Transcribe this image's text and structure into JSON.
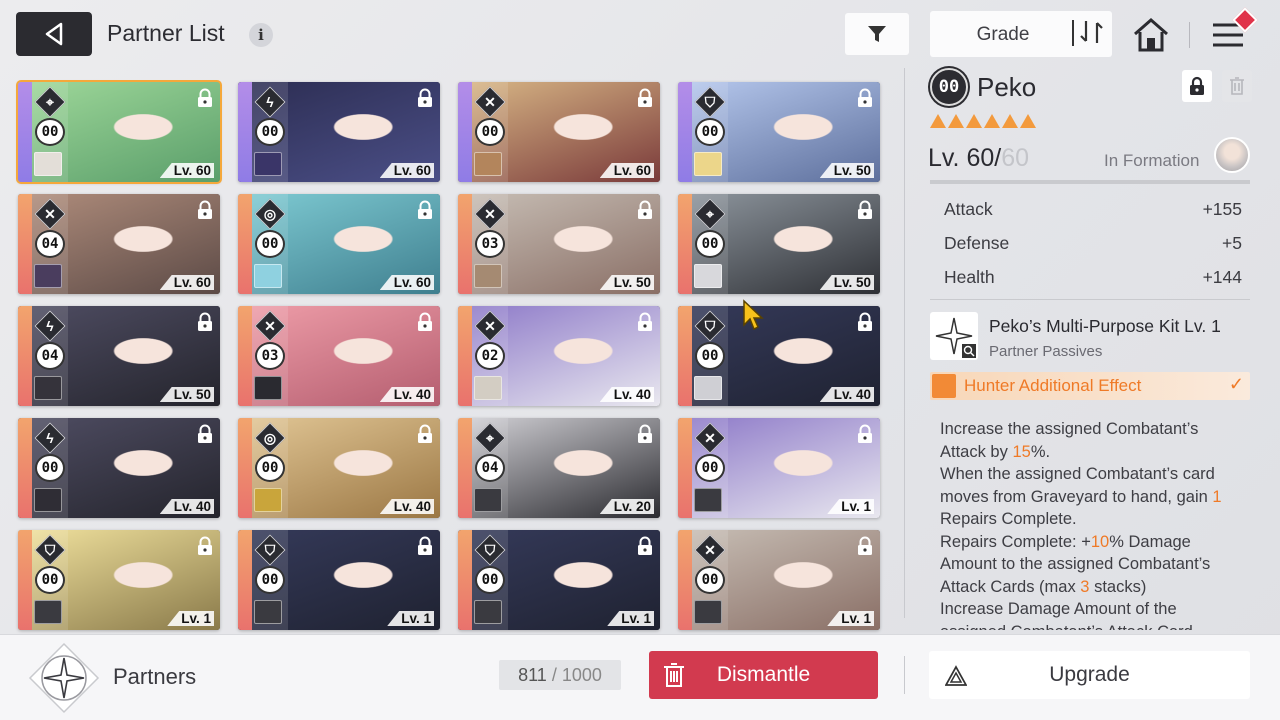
{
  "header": {
    "title": "Partner List",
    "info_icon": "i",
    "sort_label": "Grade"
  },
  "colors": {
    "accent_orange": "#f39a3d",
    "dismantle_red": "#d23a4f",
    "selected_outline": "#f5a83b",
    "rarity_orange": "#ec8a6d",
    "rarity_purple": "#a38ae7"
  },
  "cards": [
    {
      "role": "scope",
      "count": "00",
      "level": "Lv. 60",
      "rarity": "purple",
      "art": [
        "#9fd89a",
        "#5a9e6a"
      ],
      "mini": "#e3ded8",
      "selected": true
    },
    {
      "role": "bolt",
      "count": "00",
      "level": "Lv. 60",
      "rarity": "purple",
      "art": [
        "#2c2d52",
        "#4b4f87"
      ],
      "mini": "#3a3568",
      "selected": false
    },
    {
      "role": "swords",
      "count": "00",
      "level": "Lv. 60",
      "rarity": "purple",
      "art": [
        "#d9b887",
        "#7a3a3a"
      ],
      "mini": "#b3855c",
      "selected": false
    },
    {
      "role": "shield",
      "count": "00",
      "level": "Lv. 50",
      "rarity": "purple",
      "art": [
        "#b7c9ee",
        "#5d6f9c"
      ],
      "mini": "#ecd68a",
      "selected": false
    },
    {
      "role": "swords",
      "count": "04",
      "level": "Lv. 60",
      "rarity": "orange",
      "art": [
        "#b08d7c",
        "#5c4a46"
      ],
      "mini": "#4a3d5e",
      "selected": false
    },
    {
      "role": "target",
      "count": "00",
      "level": "Lv. 60",
      "rarity": "orange",
      "art": [
        "#7fcbd3",
        "#3f7f8f"
      ],
      "mini": "#8fd1e0",
      "selected": false
    },
    {
      "role": "swords",
      "count": "03",
      "level": "Lv. 50",
      "rarity": "orange",
      "art": [
        "#c8bfb6",
        "#8a6f66"
      ],
      "mini": "#a58a72",
      "selected": false
    },
    {
      "role": "scope",
      "count": "00",
      "level": "Lv. 50",
      "rarity": "orange",
      "art": [
        "#8f979f",
        "#2e3035"
      ],
      "mini": "#d8d8dc",
      "selected": false
    },
    {
      "role": "bolt",
      "count": "04",
      "level": "Lv. 50",
      "rarity": "orange",
      "art": [
        "#4f4d63",
        "#24242c"
      ],
      "mini": "#35333b",
      "selected": false
    },
    {
      "role": "swords",
      "count": "03",
      "level": "Lv. 40",
      "rarity": "orange",
      "art": [
        "#ef9ea9",
        "#b45d6f"
      ],
      "mini": "#2a2a30",
      "selected": false
    },
    {
      "role": "swords",
      "count": "02",
      "level": "Lv. 40",
      "rarity": "orange",
      "art": [
        "#8c78c8",
        "#e9e8ef"
      ],
      "mini": "#d3cdc3",
      "selected": false
    },
    {
      "role": "shield",
      "count": "00",
      "level": "Lv. 40",
      "rarity": "orange",
      "art": [
        "#353a5a",
        "#1f2231"
      ],
      "mini": "#cfcfd4",
      "selected": false
    },
    {
      "role": "bolt",
      "count": "00",
      "level": "Lv. 40",
      "rarity": "orange",
      "art": [
        "#4f4d63",
        "#24242c"
      ],
      "mini": "#2f2d35",
      "selected": false
    },
    {
      "role": "target",
      "count": "00",
      "level": "Lv. 40",
      "rarity": "orange",
      "art": [
        "#e2c796",
        "#9b7744"
      ],
      "mini": "#c9a53b",
      "selected": false
    },
    {
      "role": "scope",
      "count": "04",
      "level": "Lv. 20",
      "rarity": "orange",
      "art": [
        "#d4d3d8",
        "#2b2b30"
      ],
      "mini": "#3a3a40",
      "selected": false
    },
    {
      "role": "swords",
      "count": "00",
      "level": "Lv. 1",
      "rarity": "orange",
      "art": [
        "#8c78c8",
        "#e9e8ef"
      ],
      "mini": "#3a3a40",
      "selected": false
    },
    {
      "role": "shield",
      "count": "00",
      "level": "Lv. 1",
      "rarity": "orange",
      "art": [
        "#f1e29e",
        "#8a7a4a"
      ],
      "mini": "#3a3a40",
      "selected": false
    },
    {
      "role": "shield",
      "count": "00",
      "level": "Lv. 1",
      "rarity": "orange",
      "art": [
        "#353a5a",
        "#1f2231"
      ],
      "mini": "#3a3a40",
      "selected": false
    },
    {
      "role": "shield",
      "count": "00",
      "level": "Lv. 1",
      "rarity": "orange",
      "art": [
        "#353a5a",
        "#1f2231"
      ],
      "mini": "#3a3a40",
      "selected": false
    },
    {
      "role": "swords",
      "count": "00",
      "level": "Lv. 1",
      "rarity": "orange",
      "art": [
        "#c8bfb6",
        "#8a6f66"
      ],
      "mini": "#3a3a40",
      "selected": false
    }
  ],
  "detail": {
    "badge": "00",
    "name": "Peko",
    "level_current": "Lv. 60/",
    "level_max": "60",
    "formation_label": "In Formation",
    "stats": [
      {
        "label": "Attack",
        "value": "+155"
      },
      {
        "label": "Defense",
        "value": "+5"
      },
      {
        "label": "Health",
        "value": "+144"
      }
    ],
    "skill_name": "Peko’s Multi-Purpose Kit Lv. 1",
    "skill_sub": "Partner Passives",
    "hunter_label": "Hunter Additional Effect",
    "desc_parts": [
      {
        "t": "Increase the assigned Combatant’s Attack by ",
        "hl": false
      },
      {
        "t": "15",
        "hl": true
      },
      {
        "t": "%.\nWhen the assigned Combatant’s card moves from Graveyard to hand, gain ",
        "hl": false
      },
      {
        "t": "1",
        "hl": true
      },
      {
        "t": " Repairs Complete.\nRepairs Complete: +",
        "hl": false
      },
      {
        "t": "10",
        "hl": true
      },
      {
        "t": "% Damage Amount to the assigned Combatant’s Attack Cards (max ",
        "hl": false
      },
      {
        "t": "3",
        "hl": true
      },
      {
        "t": " stacks)\nIncrease Damage Amount of the assigned Combatant’s Attack Card",
        "hl": false
      }
    ]
  },
  "footer": {
    "section_label": "Partners",
    "capacity_current": "811",
    "capacity_max": " / 1000",
    "dismantle_label": "Dismantle",
    "upgrade_label": "Upgrade"
  }
}
